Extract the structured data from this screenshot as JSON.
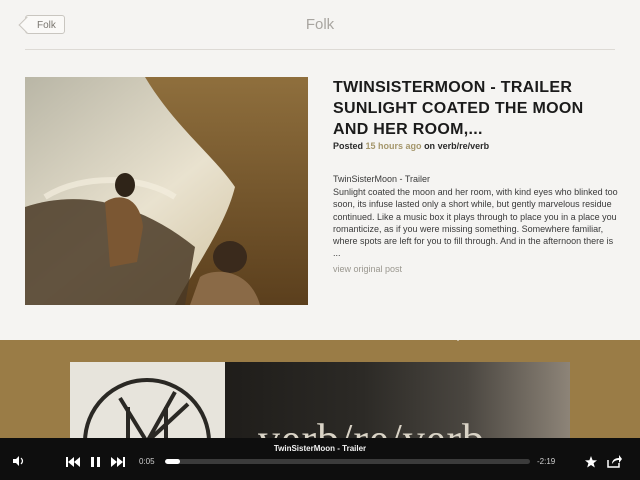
{
  "header": {
    "back_label": "Folk",
    "title": "Folk"
  },
  "article": {
    "headline": "TWINSISTERMOON - TRAILER SUNLIGHT COATED THE MOON AND HER ROOM,...",
    "posted_label": "Posted",
    "time_ago": "15 hours ago",
    "on_label": "on",
    "source": "verb/re/verb",
    "body_title": "TwinSisterMoon - Trailer",
    "body_text": "Sunlight coated the moon and her room, with kind eyes who blinked too soon, its infuse lasted only a short while, but gently marvelous residue continued. Like a music box it plays through to place you in a place you romanticize, as if you were missing something. Somewhere familiar, where spots are left for you to fill through. And in the afternoon there is ...",
    "view_original": "view original post"
  },
  "banner": {
    "text": "verb/re/verb"
  },
  "player": {
    "track_title": "TwinSisterMoon - Trailer",
    "elapsed": "0:05",
    "remaining": "-2:19",
    "progress": 0.04,
    "icons": [
      "volume-icon",
      "previous-icon",
      "pause-icon",
      "next-icon",
      "star-icon",
      "share-icon"
    ]
  },
  "colors": {
    "accent_time": "#a5976c",
    "bottom_bg": "#9a7c46",
    "player_bg": "#0e0e0e"
  }
}
